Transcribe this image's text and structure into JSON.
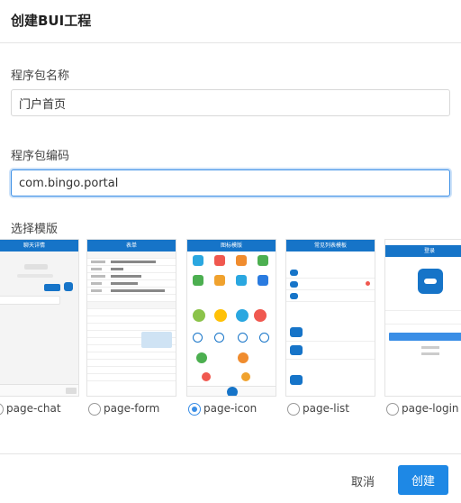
{
  "dialog": {
    "title": "创建BUI工程"
  },
  "form": {
    "package_name_label": "程序包名称",
    "package_name_value": "门户首页",
    "package_code_label": "程序包编码",
    "package_code_value": "com.bingo.portal",
    "template_label": "选择模版"
  },
  "templates": [
    {
      "label": "page-chat",
      "checked": false,
      "thumb_title": "聊天详情"
    },
    {
      "label": "page-form",
      "checked": false,
      "thumb_title": "表单"
    },
    {
      "label": "page-icon",
      "checked": true,
      "thumb_title": "图标模版"
    },
    {
      "label": "page-list",
      "checked": false,
      "thumb_title": "常见列表模板"
    },
    {
      "label": "page-login",
      "checked": false,
      "thumb_title": "登录"
    }
  ],
  "footer": {
    "cancel_label": "取消",
    "create_label": "创建"
  },
  "colors": {
    "accent": "#1e88e5",
    "thumb_header": "#1674c8",
    "focus_border": "#3a8ee6"
  }
}
